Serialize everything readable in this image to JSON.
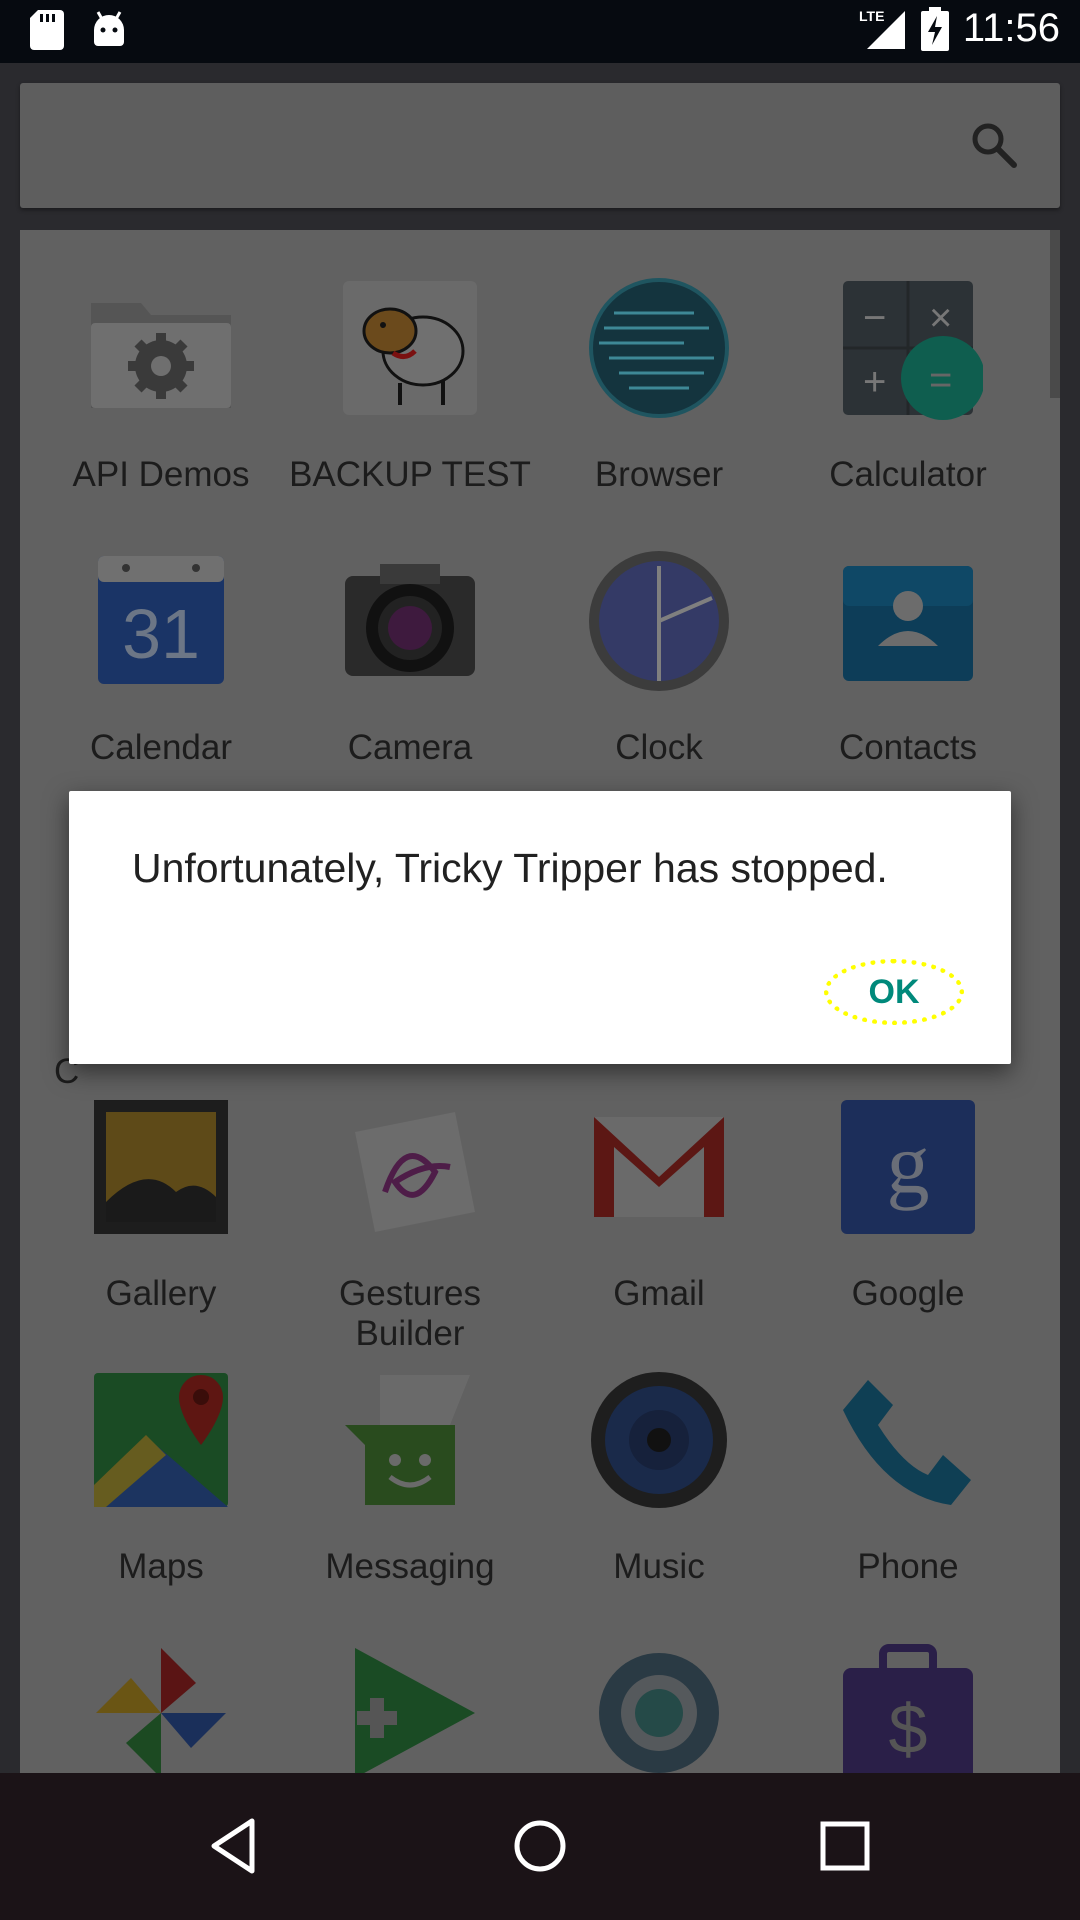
{
  "status_bar": {
    "time": "11:56",
    "network": "LTE",
    "icons": [
      "sd-card-icon",
      "android-debug-icon",
      "lte-signal-icon",
      "battery-charging-icon"
    ]
  },
  "search": {
    "icon": "search-icon"
  },
  "apps": [
    {
      "label": "API Demos",
      "icon": "folder-gear-icon"
    },
    {
      "label": "BACKUP TEST",
      "icon": "sheep-icon"
    },
    {
      "label": "Browser",
      "icon": "globe-icon"
    },
    {
      "label": "Calculator",
      "icon": "calculator-icon"
    },
    {
      "label": "Calendar",
      "icon": "calendar-icon",
      "day": "31"
    },
    {
      "label": "Camera",
      "icon": "camera-icon"
    },
    {
      "label": "Clock",
      "icon": "clock-icon"
    },
    {
      "label": "Contacts",
      "icon": "contacts-icon"
    },
    {
      "label": "Gallery",
      "icon": "gallery-icon"
    },
    {
      "label": "Gestures Builder",
      "icon": "gestures-icon"
    },
    {
      "label": "Gmail",
      "icon": "gmail-icon"
    },
    {
      "label": "Google",
      "icon": "google-icon"
    },
    {
      "label": "Maps",
      "icon": "maps-icon"
    },
    {
      "label": "Messaging",
      "icon": "messaging-icon"
    },
    {
      "label": "Music",
      "icon": "music-icon"
    },
    {
      "label": "Phone",
      "icon": "phone-icon"
    }
  ],
  "partial_letter": "C",
  "dialog": {
    "message": "Unfortunately, Tricky Tripper has stopped.",
    "ok_label": "OK"
  },
  "colors": {
    "accent": "#00897b",
    "highlight": "#ffff00"
  }
}
